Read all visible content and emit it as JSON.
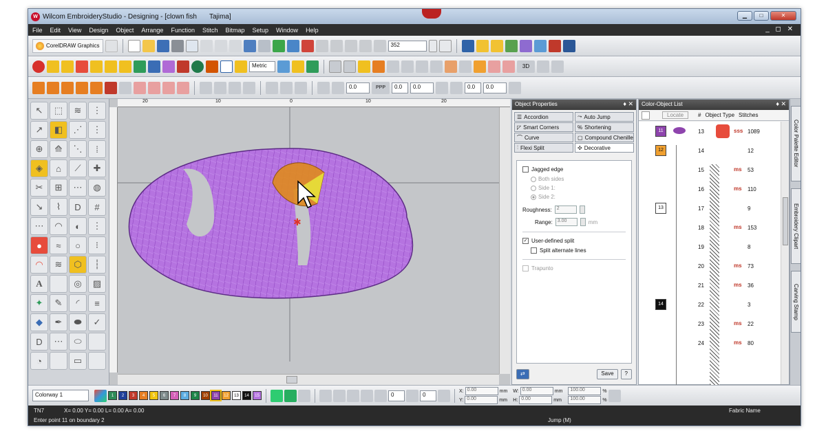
{
  "window": {
    "title": "Wilcom EmbroideryStudio - Designing - [clown fish",
    "title_tail": "Tajima]",
    "controls": {
      "minimize": "▁",
      "maximize": "□",
      "close": "✕"
    }
  },
  "menu": {
    "items": [
      "File",
      "Edit",
      "View",
      "Design",
      "Object",
      "Arrange",
      "Function",
      "Stitch",
      "Bitmap",
      "Setup",
      "Window",
      "Help"
    ],
    "right": "_ ◻ ✕"
  },
  "toolbar": {
    "corel_label": "CorelDRAW Graphics",
    "zoom_value": "352",
    "units_value": "Metric",
    "spacing_value": "0.0",
    "ppp_label": "PPP",
    "colors": {
      "accent": "#f0c020",
      "purple": "#b06ad6"
    }
  },
  "object_properties": {
    "title": "Object Properties",
    "pin": "♦ ✕",
    "tabs_row1": [
      "Accordion",
      "Auto Jump"
    ],
    "tabs_row2": [
      "Smart Corners",
      "Shortening"
    ],
    "tabs_row3": [
      "Curve",
      "Compound Chenille"
    ],
    "tabs_row4": [
      "Flexi Split",
      "Decorative"
    ],
    "jagged_edge": "Jagged edge",
    "both_sides": "Both sides",
    "side1": "Side 1:",
    "side2": "Side 2:",
    "roughness_label": "Roughness:",
    "roughness_value": "2",
    "range_label": "Range:",
    "range_value": "3.00",
    "range_unit": "mm",
    "user_defined_split": "User-defined split",
    "split_alternate": "Split alternate lines",
    "trapunto": "Trapunto",
    "save_label": "Save",
    "help_label": "?"
  },
  "color_object_list": {
    "title": "Color-Object List",
    "pin": "♦ ✕",
    "locate": "Locate",
    "hash": "#",
    "object_type": "Object Type",
    "stitches": "Stitches",
    "rows": [
      {
        "num": "13",
        "stitches": "1089"
      },
      {
        "num": "14",
        "stitches": "12"
      },
      {
        "num": "15",
        "stitches": "53"
      },
      {
        "num": "16",
        "stitches": "110"
      },
      {
        "num": "17",
        "stitches": "9"
      },
      {
        "num": "18",
        "stitches": "153"
      },
      {
        "num": "19",
        "stitches": "8"
      },
      {
        "num": "20",
        "stitches": "73"
      },
      {
        "num": "21",
        "stitches": "36"
      },
      {
        "num": "22",
        "stitches": "3"
      },
      {
        "num": "23",
        "stitches": "22"
      },
      {
        "num": "24",
        "stitches": "80"
      }
    ],
    "color_labels": [
      "11",
      "12",
      "13",
      "14"
    ]
  },
  "side_tabs": [
    "Color Palette Editor",
    "Embroidery Clipart",
    "Carving Stamp"
  ],
  "bottom_toolbar": {
    "colorway": "Colorway 1",
    "swatches": [
      "1",
      "2",
      "3",
      "4",
      "5",
      "6",
      "7",
      "8",
      "9",
      "10",
      "11",
      "12",
      "13",
      "14",
      "15"
    ],
    "x_label": "X:",
    "x_value": "0.00",
    "y_label": "Y:",
    "y_value": "0.00",
    "w_label": "W:",
    "w_value": "0.00",
    "h_label": "H:",
    "h_value": "0.00",
    "mm": "mm",
    "pct1": "100.00",
    "pct2": "100.00",
    "pct": "%"
  },
  "status": {
    "mode": "TN7",
    "coords": "X= 0.00 Y= 0.00 L= 0.00 A= 0.00",
    "prompt": "Enter point 11 on boundary 2",
    "jump": "Jump (M)",
    "fabric": "Fabric Name"
  },
  "ruler": {
    "labels": [
      "20",
      "10",
      "0",
      "10",
      "20"
    ]
  }
}
